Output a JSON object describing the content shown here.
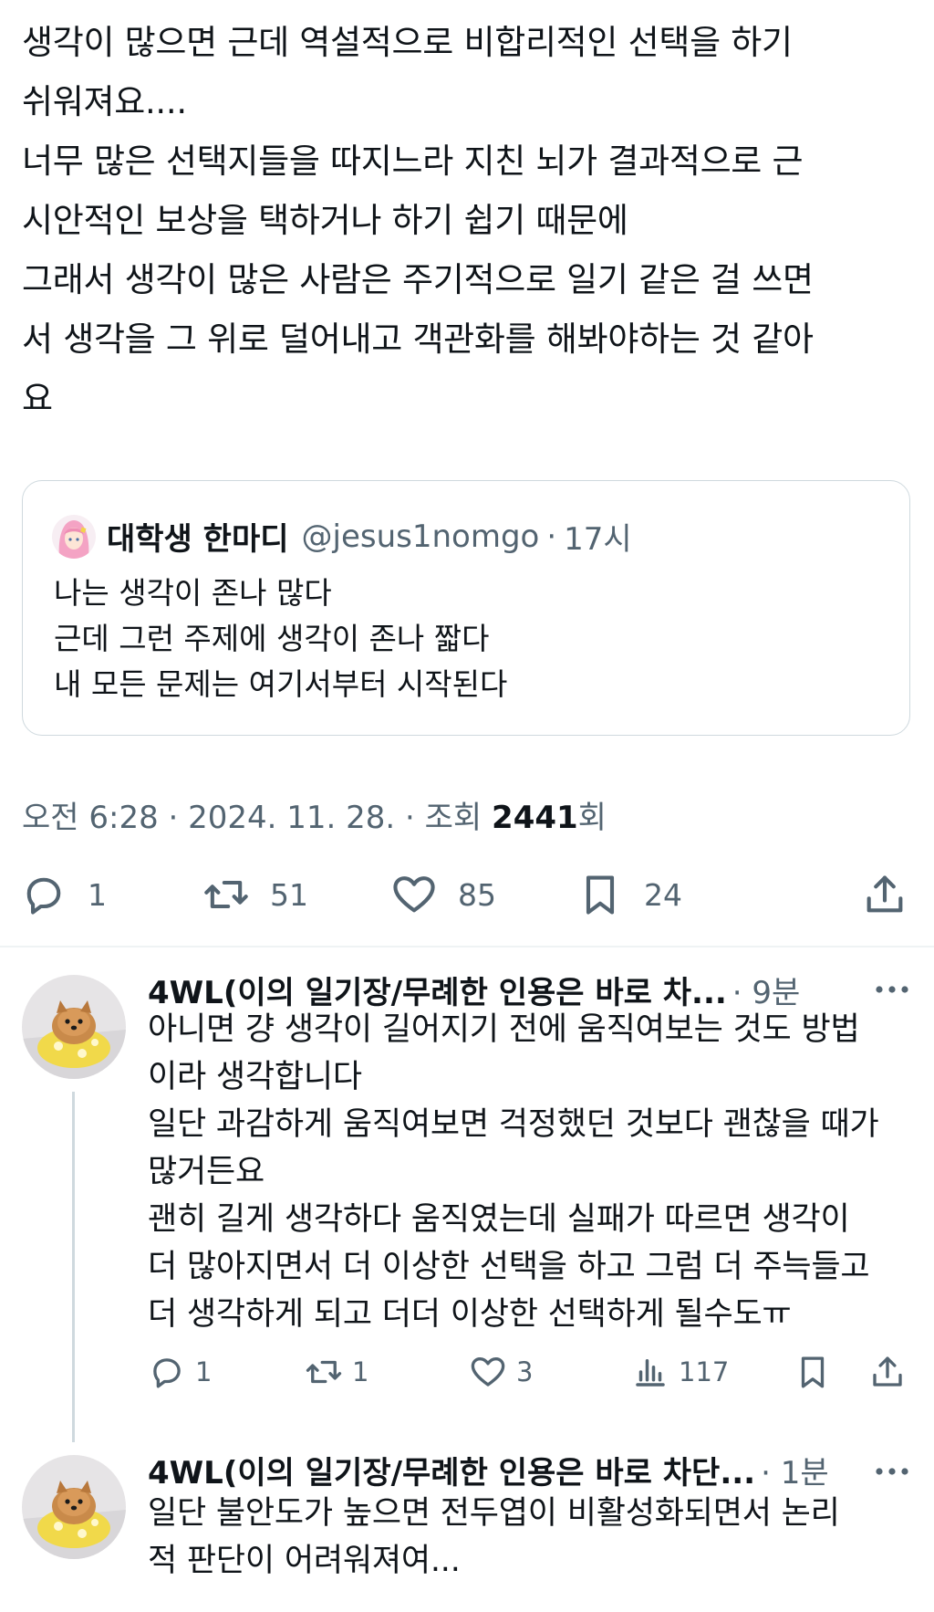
{
  "post": {
    "text": "생각이 많으면 근데 역설적으로 비합리적인 선택을 하기\n쉬워져요....\n너무 많은 선택지들을 따지느라 지친 뇌가 결과적으로 근\n시안적인 보상을 택하거나 하기 쉽기 때문에\n그래서 생각이 많은 사람은 주기적으로 일기 같은 걸 쓰면\n서 생각을 그 위로 덜어내고 객관화를 해봐야하는 것 같아\n요"
  },
  "quote": {
    "author_name": "대학생 한마디",
    "handle": "@jesus1nomgo",
    "separator": "·",
    "time": "17시",
    "text": "나는 생각이 존나 많다\n근데 그런 주제에 생각이 존나 짧다\n내 모든 문제는 여기서부터 시작된다"
  },
  "meta": {
    "prefix": "오전 6:28 · 2024. 11. 28. · 조회 ",
    "views": "2441",
    "suffix": "회"
  },
  "actions": {
    "reply_count": "1",
    "retweet_count": "51",
    "like_count": "85",
    "bookmark_count": "24"
  },
  "replies": [
    {
      "author": "4WL(이의 일기장/무례한 인용은 바로 차...",
      "time": "· 9분",
      "text": "아니면 걍 생각이 길어지기 전에 움직여보는 것도 방법\n이라 생각합니다\n일단 과감하게 움직여보면 걱정했던 것보다 괜찮을 때가\n많거든요\n괜히 길게 생각하다 움직였는데 실패가 따르면 생각이\n더 많아지면서 더 이상한 선택을 하고 그럼 더 주늑들고\n더 생각하게 되고 더더 이상한 선택하게 될수도ㅠ",
      "reply_count": "1",
      "retweet_count": "1",
      "like_count": "3",
      "view_count": "117"
    },
    {
      "author": "4WL(이의 일기장/무례한 인용은 바로 차단...",
      "time": "· 1분",
      "text": "일단 불안도가 높으면 전두엽이 비활성화되면서 논리\n적 판단이 어려워져여..."
    }
  ],
  "colors": {
    "text": "#0f1419",
    "secondary": "#536471",
    "border": "#cfd9de",
    "divider": "#eff3f4"
  },
  "icons": [
    "reply-icon",
    "retweet-icon",
    "like-icon",
    "bookmark-icon",
    "share-icon",
    "views-icon",
    "more-icon"
  ]
}
